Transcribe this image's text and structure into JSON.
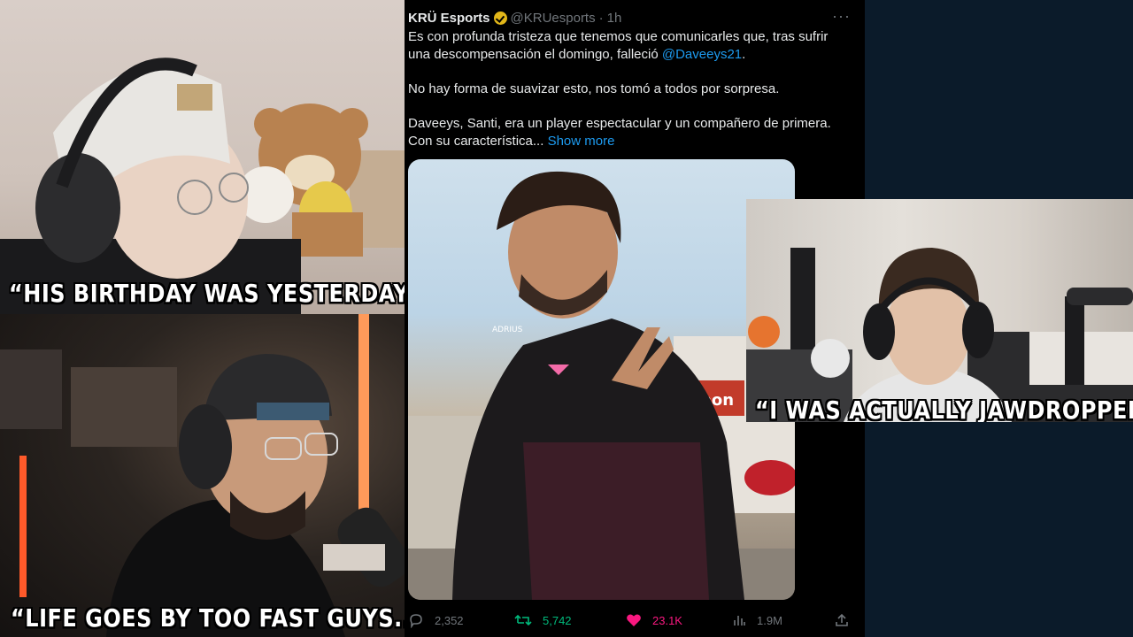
{
  "captions": {
    "top_left": "“HIS BIRTHDAY WAS YESTERDAY?”",
    "bottom_left": "“LIFE GOES BY TOO FAST GUYS..”",
    "right": "“I WAS ACTUALLY JAWDROPPED”"
  },
  "tweet": {
    "name": "KRÜ Esports",
    "handle": "@KRUesports",
    "separator": "·",
    "time": "1h",
    "more": "···",
    "paragraph1_a": "Es con profunda tristeza que tenemos que comunicarles que, tras sufrir una descompensación el domingo, falleció ",
    "mention": "@Daveeys21",
    "paragraph1_b": ".",
    "paragraph2": "No hay forma de suavizar esto, nos tomó a todos por sorpresa.",
    "paragraph3": "Daveeys, Santi, era un player espectacular y un compañero de primera. Con su característica...",
    "show_more": "Show more",
    "media_text_shirt": "ADRIUS",
    "media_store_sign": "imon",
    "stats": {
      "replies": "2,352",
      "retweets": "5,742",
      "likes": "23.1K",
      "views": "1.9M"
    }
  },
  "colors": {
    "tweet_bg": "#000000",
    "link": "#1d9bf0",
    "retweet": "#00ba7c",
    "like": "#f91880",
    "muted": "#71767b",
    "page_bg": "#0b1b2a"
  }
}
